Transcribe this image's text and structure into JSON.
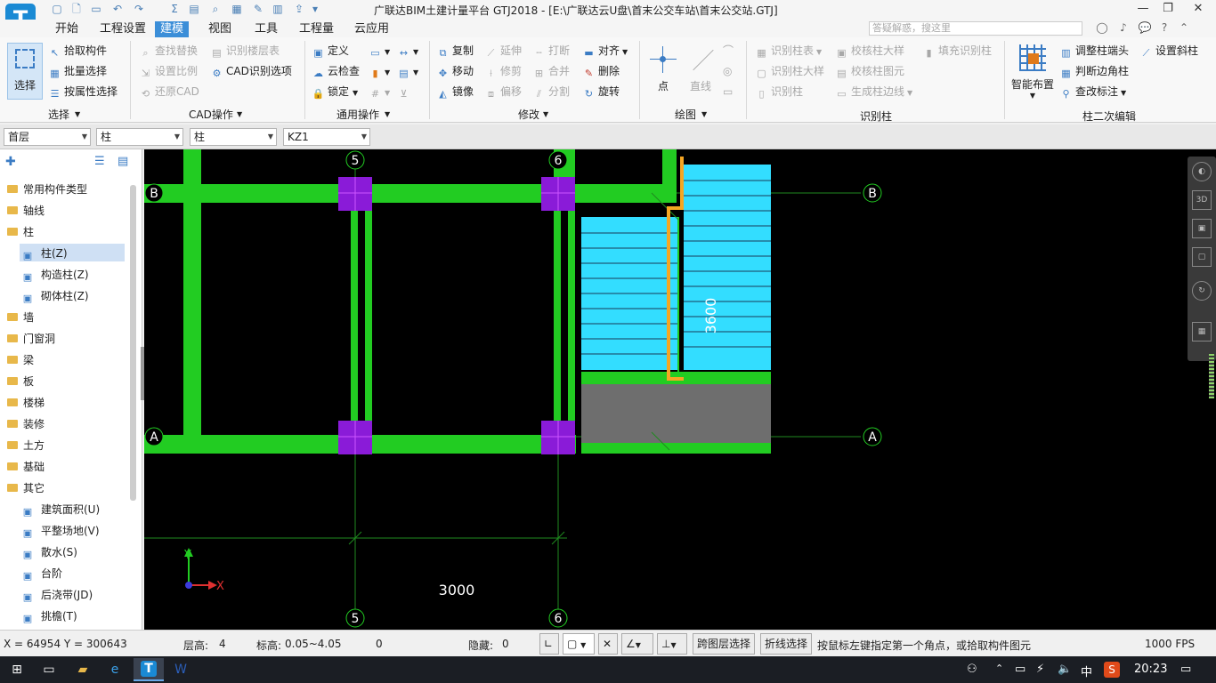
{
  "window": {
    "title": "广联达BIM土建计量平台 GTJ2018 - [E:\\广联达云U盘\\首末公交车站\\首末公交站.GTJ]",
    "logo": "T"
  },
  "menu": {
    "tabs": [
      "开始",
      "工程设置",
      "建模",
      "视图",
      "工具",
      "工程量",
      "云应用"
    ],
    "active": "建模",
    "search_placeholder": "答疑解惑，搜这里"
  },
  "ribbon": {
    "select": {
      "big": "选择",
      "items": [
        "拾取构件",
        "批量选择",
        "按属性选择"
      ],
      "group": "选择"
    },
    "cad": {
      "items": [
        "查找替换",
        "识别楼层表",
        "设置比例",
        "CAD识别选项",
        "还原CAD"
      ],
      "group": "CAD操作"
    },
    "general": {
      "items": [
        "定义",
        "云检查",
        "锁定"
      ],
      "group": "通用操作"
    },
    "modify": {
      "items": [
        "复制",
        "延伸",
        "打断",
        "对齐",
        "移动",
        "修剪",
        "合并",
        "删除",
        "镜像",
        "偏移",
        "分割",
        "旋转"
      ],
      "group": "修改"
    },
    "draw": {
      "items": [
        "点",
        "直线"
      ],
      "group": "绘图"
    },
    "recog": {
      "items": [
        "识别柱表",
        "校核柱大样",
        "填充识别柱",
        "识别柱大样",
        "校核柱图元",
        "识别柱",
        "生成柱边线"
      ],
      "group": "识别柱"
    },
    "column_edit": {
      "big": "智能布置",
      "items": [
        "调整柱端头",
        "设置斜柱",
        "判断边角柱",
        "查改标注"
      ],
      "group": "柱二次编辑"
    }
  },
  "propbar": {
    "floor": "首层",
    "type": "柱",
    "subtype": "柱",
    "component": "KZ1"
  },
  "tree": {
    "items": [
      {
        "label": "常用构件类型",
        "kind": "folder"
      },
      {
        "label": "轴线",
        "kind": "folder"
      },
      {
        "label": "柱",
        "kind": "folder-open"
      },
      {
        "label": "柱(Z)",
        "kind": "child",
        "selected": true
      },
      {
        "label": "构造柱(Z)",
        "kind": "child"
      },
      {
        "label": "砌体柱(Z)",
        "kind": "child"
      },
      {
        "label": "墙",
        "kind": "folder"
      },
      {
        "label": "门窗洞",
        "kind": "folder"
      },
      {
        "label": "梁",
        "kind": "folder"
      },
      {
        "label": "板",
        "kind": "folder"
      },
      {
        "label": "楼梯",
        "kind": "folder"
      },
      {
        "label": "装修",
        "kind": "folder"
      },
      {
        "label": "土方",
        "kind": "folder"
      },
      {
        "label": "基础",
        "kind": "folder"
      },
      {
        "label": "其它",
        "kind": "folder-open"
      },
      {
        "label": "建筑面积(U)",
        "kind": "child"
      },
      {
        "label": "平整场地(V)",
        "kind": "child"
      },
      {
        "label": "散水(S)",
        "kind": "child"
      },
      {
        "label": "台阶",
        "kind": "child"
      },
      {
        "label": "后浇带(JD)",
        "kind": "child"
      },
      {
        "label": "挑檐(T)",
        "kind": "child"
      }
    ]
  },
  "canvas": {
    "axis_labels": {
      "col5": "5",
      "col6": "6",
      "rowA": "A",
      "rowB": "B"
    },
    "dimension_span": "3000",
    "dimension_stair": "3600",
    "ucs": {
      "x": "X",
      "y": "Y"
    }
  },
  "status": {
    "coords": "X = 64954 Y = 300643",
    "floor_height_label": "层高:",
    "floor_height": "4",
    "elevation_label": "标高:",
    "elevation": "0.05~4.05",
    "value0": "0",
    "hidden_label": "隐藏:",
    "hidden": "0",
    "cross_layer": "跨图层选择",
    "polyline_select": "折线选择",
    "hint": "按鼠标左键指定第一个角点，或拾取构件图元",
    "fps": "1000 FPS"
  },
  "taskbar": {
    "ime": "中",
    "time": "20:23"
  },
  "colors": {
    "accent": "#3b8ed8",
    "beam": "#22cc22",
    "column": "#8a1bd8",
    "stair": "#33ddff",
    "highlight": "#f5a623",
    "slab": "#6e6e6e"
  }
}
